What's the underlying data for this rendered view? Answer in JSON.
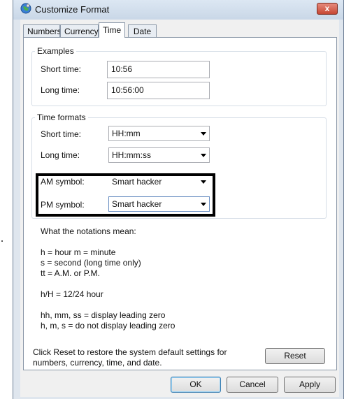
{
  "window": {
    "title": "Customize Format",
    "close_label": "x"
  },
  "tabs": [
    {
      "label": "Numbers",
      "active": false
    },
    {
      "label": "Currency",
      "active": false
    },
    {
      "label": "Time",
      "active": true
    },
    {
      "label": "Date",
      "active": false
    }
  ],
  "examples": {
    "title": "Examples",
    "short_label": "Short time:",
    "short_value": "10:56",
    "long_label": "Long time:",
    "long_value": "10:56:00"
  },
  "time_formats": {
    "title": "Time formats",
    "short_label": "Short time:",
    "short_value": "HH:mm",
    "long_label": "Long time:",
    "long_value": "HH:mm:ss",
    "am_label": "AM symbol:",
    "am_value": "Smart hacker",
    "pm_label": "PM symbol:",
    "pm_value": "Smart hacker"
  },
  "notations": {
    "heading": "What the notations mean:",
    "line1": "h = hour   m = minute",
    "line2": "s = second (long time only)",
    "line3": "tt = A.M. or P.M.",
    "line4": "h/H = 12/24 hour",
    "line5": "hh, mm, ss = display leading zero",
    "line6": "h, m, s = do not display leading zero"
  },
  "reset": {
    "text_line1": "Click Reset to restore the system default settings for",
    "text_line2": "numbers, currency, time, and date.",
    "button_label": "Reset"
  },
  "footer": {
    "ok_label": "OK",
    "cancel_label": "Cancel",
    "apply_label": "Apply"
  },
  "colors": {
    "window_frame": "#dfe6ee",
    "panel": "#ffffff",
    "highlight_border": "#000000"
  }
}
